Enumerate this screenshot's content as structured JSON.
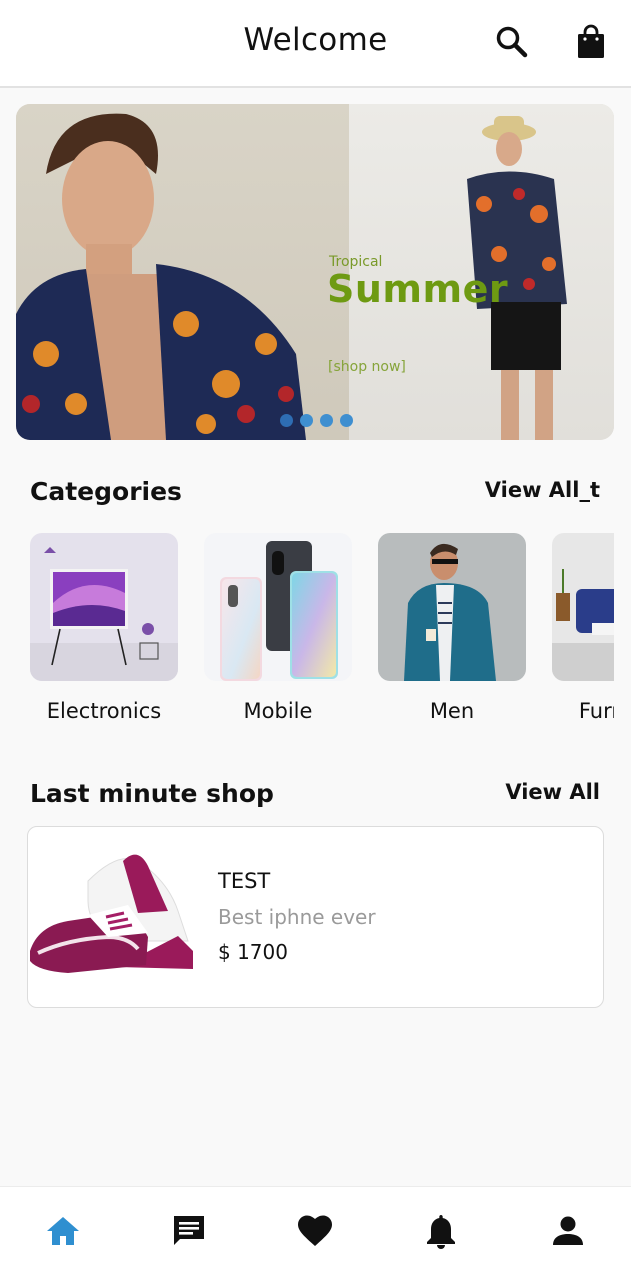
{
  "header": {
    "title": "Welcome",
    "icons": [
      "search-icon",
      "shopping-bag-icon"
    ]
  },
  "banner": {
    "subtitle": "Tropical",
    "headline": "Summer",
    "cta": "[shop now]",
    "slide_count": 4,
    "active_slide": 1
  },
  "categories": {
    "title": "Categories",
    "view_all": "View All_t",
    "items": [
      {
        "label": "Electronics"
      },
      {
        "label": "Mobile"
      },
      {
        "label": "Men"
      },
      {
        "label": "Furniture"
      }
    ]
  },
  "last_minute": {
    "title": "Last minute shop",
    "view_all": "View All",
    "products": [
      {
        "name": "TEST",
        "description": "Best iphne ever",
        "price": "$ 1700"
      }
    ]
  },
  "bottom_nav": {
    "items": [
      "home-icon",
      "chat-icon",
      "heart-icon",
      "bell-icon",
      "person-icon"
    ],
    "active": "home-icon"
  },
  "colors": {
    "accent": "#2f8fd0",
    "banner_green": "#6e9a12"
  }
}
